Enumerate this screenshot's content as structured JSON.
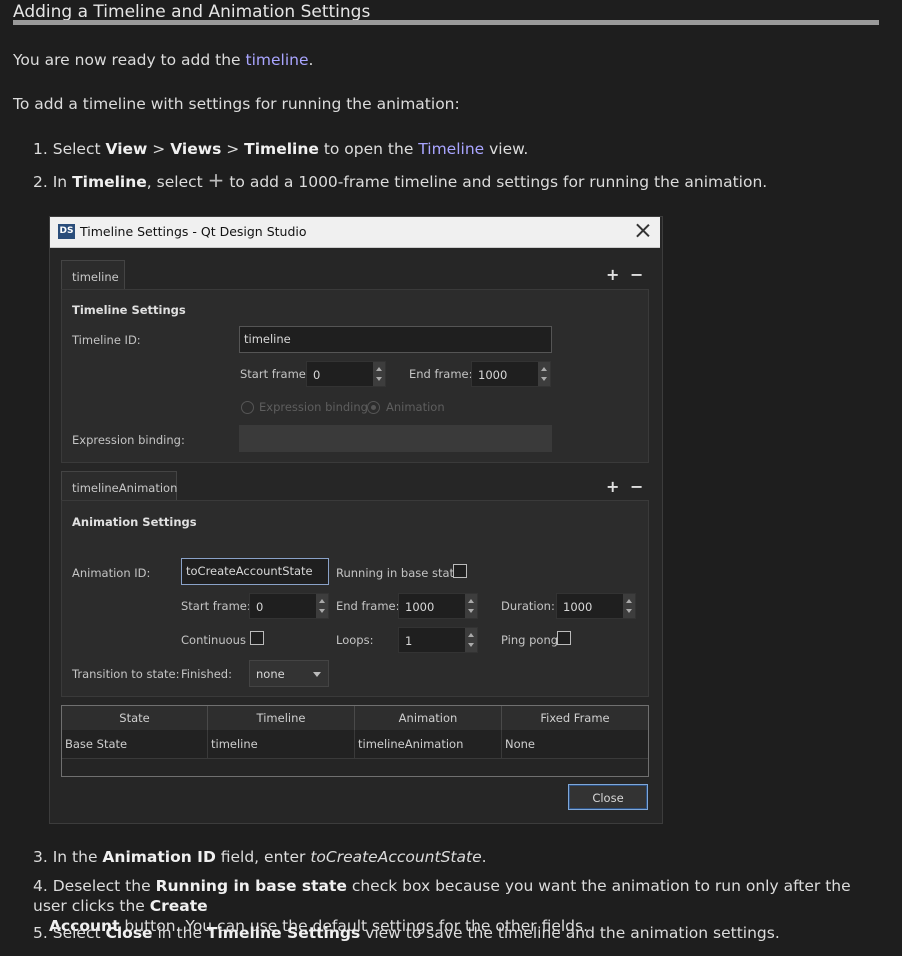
{
  "doc": {
    "title": "Adding a Timeline and Animation Settings",
    "intro_prefix": "You are now ready to add the ",
    "intro_link": "timeline",
    "intro_suffix": ".",
    "para2": "To add a timeline with settings for running the animation:",
    "step1": {
      "num": "1.",
      "t1": "Select ",
      "b1": "View",
      "t2": " > ",
      "b2": "Views",
      "t3": " > ",
      "b3": "Timeline",
      "t4": " to open the ",
      "link": "Timeline",
      "t5": " view."
    },
    "step2": {
      "num": "2.",
      "t1": "In ",
      "b1": "Timeline",
      "t2": ", select ",
      "icon": "+",
      "t3": " to add a 1000-frame timeline and settings for running the animation."
    },
    "step3": {
      "num": "3.",
      "t1": "In the ",
      "b1": "Animation ID",
      "t2": " field, enter ",
      "i1": "toCreateAccountState",
      "t3": "."
    },
    "step4": {
      "num": "4.",
      "t1": "Deselect the ",
      "b1": "Running in base state",
      "t2": " check box because you want the animation to run only after the user clicks the ",
      "b2": "Create",
      "b3": "Account",
      "t3": " button. You can use the default settings for the other fields."
    },
    "step5": {
      "num": "5.",
      "t1": "Select ",
      "b1": "Close",
      "t2": " in the ",
      "b2": "Timeline Settings",
      "t3": " view to save the timeline and the animation settings."
    }
  },
  "dialog": {
    "logo": "DS",
    "title": "Timeline Settings - Qt Design Studio",
    "timeline_tab": "timeline",
    "timeline_settings_heading": "Timeline Settings",
    "timeline_id_label": "Timeline ID:",
    "timeline_id_value": "timeline",
    "start_frame_label": "Start frame:",
    "start_frame_value": "0",
    "end_frame_label": "End frame:",
    "end_frame_value": "1000",
    "radio_expression": "Expression binding",
    "radio_animation": "Animation",
    "expression_binding_label": "Expression binding:",
    "animation_tab": "timelineAnimation",
    "animation_settings_heading": "Animation Settings",
    "animation_id_label": "Animation ID:",
    "animation_id_value": "toCreateAccountState",
    "running_base_label": "Running in base state",
    "anim_start_label": "Start frame:",
    "anim_start_value": "0",
    "anim_end_label": "End frame:",
    "anim_end_value": "1000",
    "duration_label": "Duration:",
    "duration_value": "1000",
    "continuous_label": "Continuous",
    "loops_label": "Loops:",
    "loops_value": "1",
    "pingpong_label": "Ping pong",
    "transition_label": "Transition to state:",
    "finished_label": "Finished:",
    "finished_value": "none",
    "plus": "+",
    "minus": "−",
    "table": {
      "headers": [
        "State",
        "Timeline",
        "Animation",
        "Fixed Frame"
      ],
      "row": [
        "Base State",
        "timeline",
        "timelineAnimation",
        "None"
      ]
    },
    "close_label": "Close"
  }
}
